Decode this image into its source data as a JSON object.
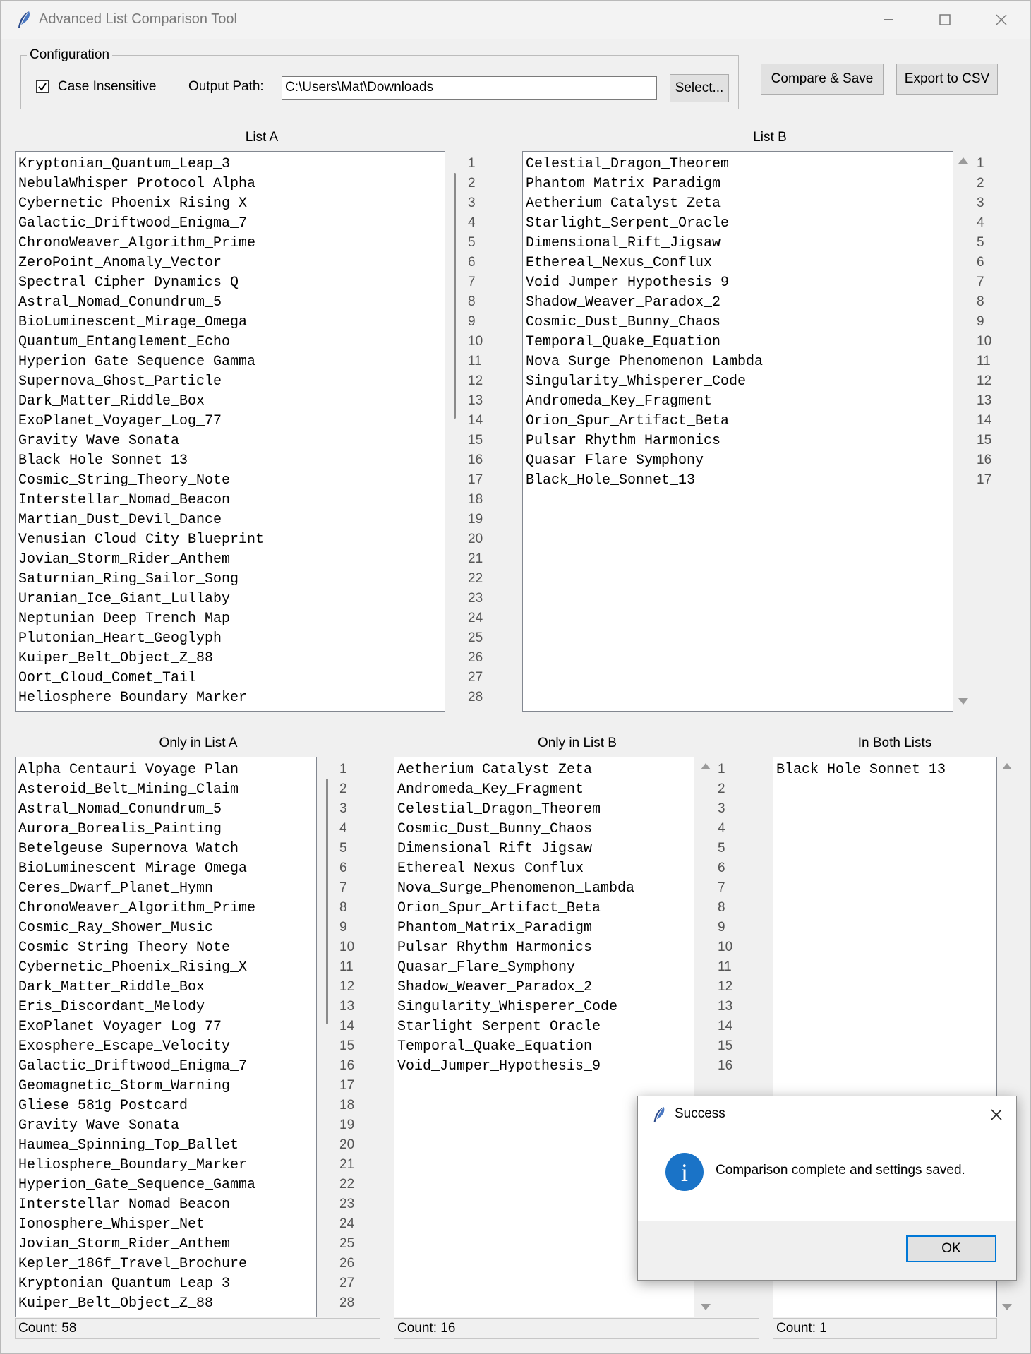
{
  "window": {
    "title": "Advanced List Comparison Tool"
  },
  "config": {
    "legend": "Configuration",
    "case_insensitive_label": "Case Insensitive",
    "case_insensitive_checked": true,
    "output_path_label": "Output Path:",
    "output_path_value": "C:\\Users\\Mat\\Downloads",
    "select_button": "Select...",
    "compare_button": "Compare & Save",
    "export_button": "Export to CSV"
  },
  "list_a": {
    "title": "List A",
    "items": [
      "Kryptonian_Quantum_Leap_3",
      "NebulaWhisper_Protocol_Alpha",
      "Cybernetic_Phoenix_Rising_X",
      "Galactic_Driftwood_Enigma_7",
      "ChronoWeaver_Algorithm_Prime",
      "ZeroPoint_Anomaly_Vector",
      "Spectral_Cipher_Dynamics_Q",
      "Astral_Nomad_Conundrum_5",
      "BioLuminescent_Mirage_Omega",
      "Quantum_Entanglement_Echo",
      "Hyperion_Gate_Sequence_Gamma",
      "Supernova_Ghost_Particle",
      "Dark_Matter_Riddle_Box",
      "ExoPlanet_Voyager_Log_77",
      "Gravity_Wave_Sonata",
      "Black_Hole_Sonnet_13",
      "Cosmic_String_Theory_Note",
      "Interstellar_Nomad_Beacon",
      "Martian_Dust_Devil_Dance",
      "Venusian_Cloud_City_Blueprint",
      "Jovian_Storm_Rider_Anthem",
      "Saturnian_Ring_Sailor_Song",
      "Uranian_Ice_Giant_Lullaby",
      "Neptunian_Deep_Trench_Map",
      "Plutonian_Heart_Geoglyph",
      "Kuiper_Belt_Object_Z_88",
      "Oort_Cloud_Comet_Tail",
      "Heliosphere_Boundary_Marker"
    ],
    "line_numbers": [
      "1",
      "2",
      "3",
      "4",
      "5",
      "6",
      "7",
      "8",
      "9",
      "10",
      "11",
      "12",
      "13",
      "14",
      "15",
      "16",
      "17",
      "18",
      "19",
      "20",
      "21",
      "22",
      "23",
      "24",
      "25",
      "26",
      "27",
      "28"
    ]
  },
  "list_b": {
    "title": "List B",
    "items": [
      "Celestial_Dragon_Theorem",
      "Phantom_Matrix_Paradigm",
      "Aetherium_Catalyst_Zeta",
      "Starlight_Serpent_Oracle",
      "Dimensional_Rift_Jigsaw",
      "Ethereal_Nexus_Conflux",
      "Void_Jumper_Hypothesis_9",
      "Shadow_Weaver_Paradox_2",
      "Cosmic_Dust_Bunny_Chaos",
      "Temporal_Quake_Equation",
      "Nova_Surge_Phenomenon_Lambda",
      "Singularity_Whisperer_Code",
      "Andromeda_Key_Fragment",
      "Orion_Spur_Artifact_Beta",
      "Pulsar_Rhythm_Harmonics",
      "Quasar_Flare_Symphony",
      "Black_Hole_Sonnet_13"
    ],
    "line_numbers": [
      "1",
      "2",
      "3",
      "4",
      "5",
      "6",
      "7",
      "8",
      "9",
      "10",
      "11",
      "12",
      "13",
      "14",
      "15",
      "16",
      "17"
    ]
  },
  "only_a": {
    "title": "Only in List A",
    "items": [
      "Alpha_Centauri_Voyage_Plan",
      "Asteroid_Belt_Mining_Claim",
      "Astral_Nomad_Conundrum_5",
      "Aurora_Borealis_Painting",
      "Betelgeuse_Supernova_Watch",
      "BioLuminescent_Mirage_Omega",
      "Ceres_Dwarf_Planet_Hymn",
      "ChronoWeaver_Algorithm_Prime",
      "Cosmic_Ray_Shower_Music",
      "Cosmic_String_Theory_Note",
      "Cybernetic_Phoenix_Rising_X",
      "Dark_Matter_Riddle_Box",
      "Eris_Discordant_Melody",
      "ExoPlanet_Voyager_Log_77",
      "Exosphere_Escape_Velocity",
      "Galactic_Driftwood_Enigma_7",
      "Geomagnetic_Storm_Warning",
      "Gliese_581g_Postcard",
      "Gravity_Wave_Sonata",
      "Haumea_Spinning_Top_Ballet",
      "Heliosphere_Boundary_Marker",
      "Hyperion_Gate_Sequence_Gamma",
      "Interstellar_Nomad_Beacon",
      "Ionosphere_Whisper_Net",
      "Jovian_Storm_Rider_Anthem",
      "Kepler_186f_Travel_Brochure",
      "Kryptonian_Quantum_Leap_3",
      "Kuiper_Belt_Object_Z_88"
    ],
    "line_numbers": [
      "1",
      "2",
      "3",
      "4",
      "5",
      "6",
      "7",
      "8",
      "9",
      "10",
      "11",
      "12",
      "13",
      "14",
      "15",
      "16",
      "17",
      "18",
      "19",
      "20",
      "21",
      "22",
      "23",
      "24",
      "25",
      "26",
      "27",
      "28"
    ],
    "count": "Count: 58"
  },
  "only_b": {
    "title": "Only in List B",
    "items": [
      "Aetherium_Catalyst_Zeta",
      "Andromeda_Key_Fragment",
      "Celestial_Dragon_Theorem",
      "Cosmic_Dust_Bunny_Chaos",
      "Dimensional_Rift_Jigsaw",
      "Ethereal_Nexus_Conflux",
      "Nova_Surge_Phenomenon_Lambda",
      "Orion_Spur_Artifact_Beta",
      "Phantom_Matrix_Paradigm",
      "Pulsar_Rhythm_Harmonics",
      "Quasar_Flare_Symphony",
      "Shadow_Weaver_Paradox_2",
      "Singularity_Whisperer_Code",
      "Starlight_Serpent_Oracle",
      "Temporal_Quake_Equation",
      "Void_Jumper_Hypothesis_9"
    ],
    "line_numbers": [
      "1",
      "2",
      "3",
      "4",
      "5",
      "6",
      "7",
      "8",
      "9",
      "10",
      "11",
      "12",
      "13",
      "14",
      "15",
      "16"
    ],
    "count": "Count: 16"
  },
  "both": {
    "title": "In Both Lists",
    "items": [
      "Black_Hole_Sonnet_13"
    ],
    "count": "Count: 1"
  },
  "dialog": {
    "title": "Success",
    "message": "Comparison complete and settings saved.",
    "ok_button": "OK",
    "info_glyph": "i"
  },
  "colors": {
    "accent": "#0078d7",
    "info_icon": "#1a73c7"
  }
}
